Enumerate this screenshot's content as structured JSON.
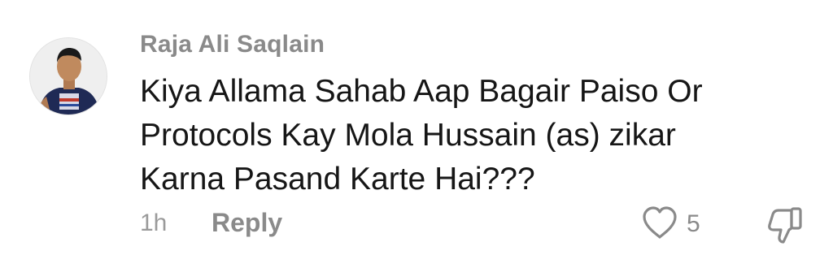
{
  "comment": {
    "username": "Raja Ali Saqlain",
    "text_lines": [
      "Kiya Allama Sahab Aap Bagair Paiso Or",
      "Protocols Kay Mola Hussain (as) zikar",
      "Karna Pasand Karte Hai???"
    ],
    "timestamp": "1h",
    "reply_label": "Reply",
    "like_count": "5",
    "icons": {
      "like": "heart-outline-icon",
      "dislike": "thumbs-down-icon"
    },
    "colors": {
      "username": "#8a8a8a",
      "text": "#161616",
      "meta": "#9a9a9a"
    }
  }
}
